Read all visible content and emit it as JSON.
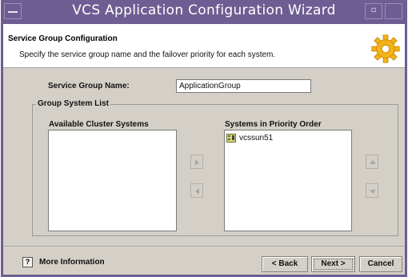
{
  "window": {
    "title": "VCS Application Configuration Wizard"
  },
  "header": {
    "title": "Service Group Configuration",
    "subtitle": "Specify the service group name and the failover priority for each system."
  },
  "form": {
    "service_group_name_label": "Service Group Name:",
    "service_group_name_value": "ApplicationGroup"
  },
  "group_system_list": {
    "legend": "Group System List",
    "available_label": "Available Cluster Systems",
    "available_items": [],
    "priority_label": "Systems in Priority Order",
    "priority_items": [
      "vcssun51"
    ]
  },
  "footer": {
    "more_info": "More Information",
    "back": "< Back",
    "next": "Next >",
    "cancel": "Cancel"
  }
}
